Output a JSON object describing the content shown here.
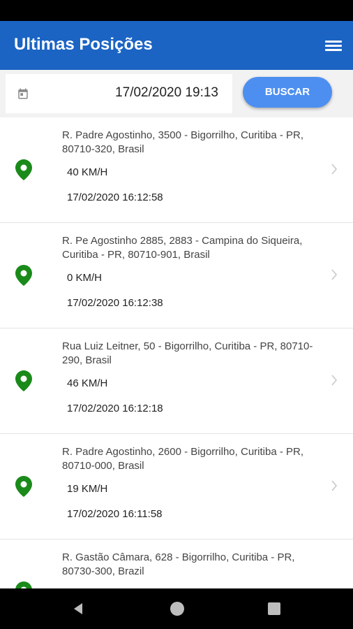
{
  "header": {
    "title": "Ultimas Posições",
    "menu_icon": "hamburger-menu-icon"
  },
  "filter": {
    "date_value": "17/02/2020 19:13",
    "calendar_icon": "calendar-icon",
    "search_label": "BUSCAR"
  },
  "positions": [
    {
      "address": "R. Padre Agostinho, 3500 - Bigorrilho, Curitiba - PR, 80710-320, Brasil",
      "speed": "40 KM/H",
      "datetime": "17/02/2020 16:12:58"
    },
    {
      "address": "R. Pe Agostinho 2885, 2883 - Campina do Siqueira, Curitiba - PR, 80710-901, Brasil",
      "speed": "0 KM/H",
      "datetime": "17/02/2020 16:12:38"
    },
    {
      "address": "Rua Luiz Leitner, 50 - Bigorrilho, Curitiba - PR, 80710-290, Brasil",
      "speed": "46 KM/H",
      "datetime": "17/02/2020 16:12:18"
    },
    {
      "address": "R. Padre Agostinho, 2600 - Bigorrilho, Curitiba - PR, 80710-000, Brasil",
      "speed": "19 KM/H",
      "datetime": "17/02/2020 16:11:58"
    },
    {
      "address": "R. Gastão Câmara, 628 - Bigorrilho, Curitiba - PR, 80730-300, Brazil"
    }
  ],
  "colors": {
    "appbar": "#1b64c4",
    "button": "#4d8ff0",
    "pin": "#1a8a1a"
  }
}
